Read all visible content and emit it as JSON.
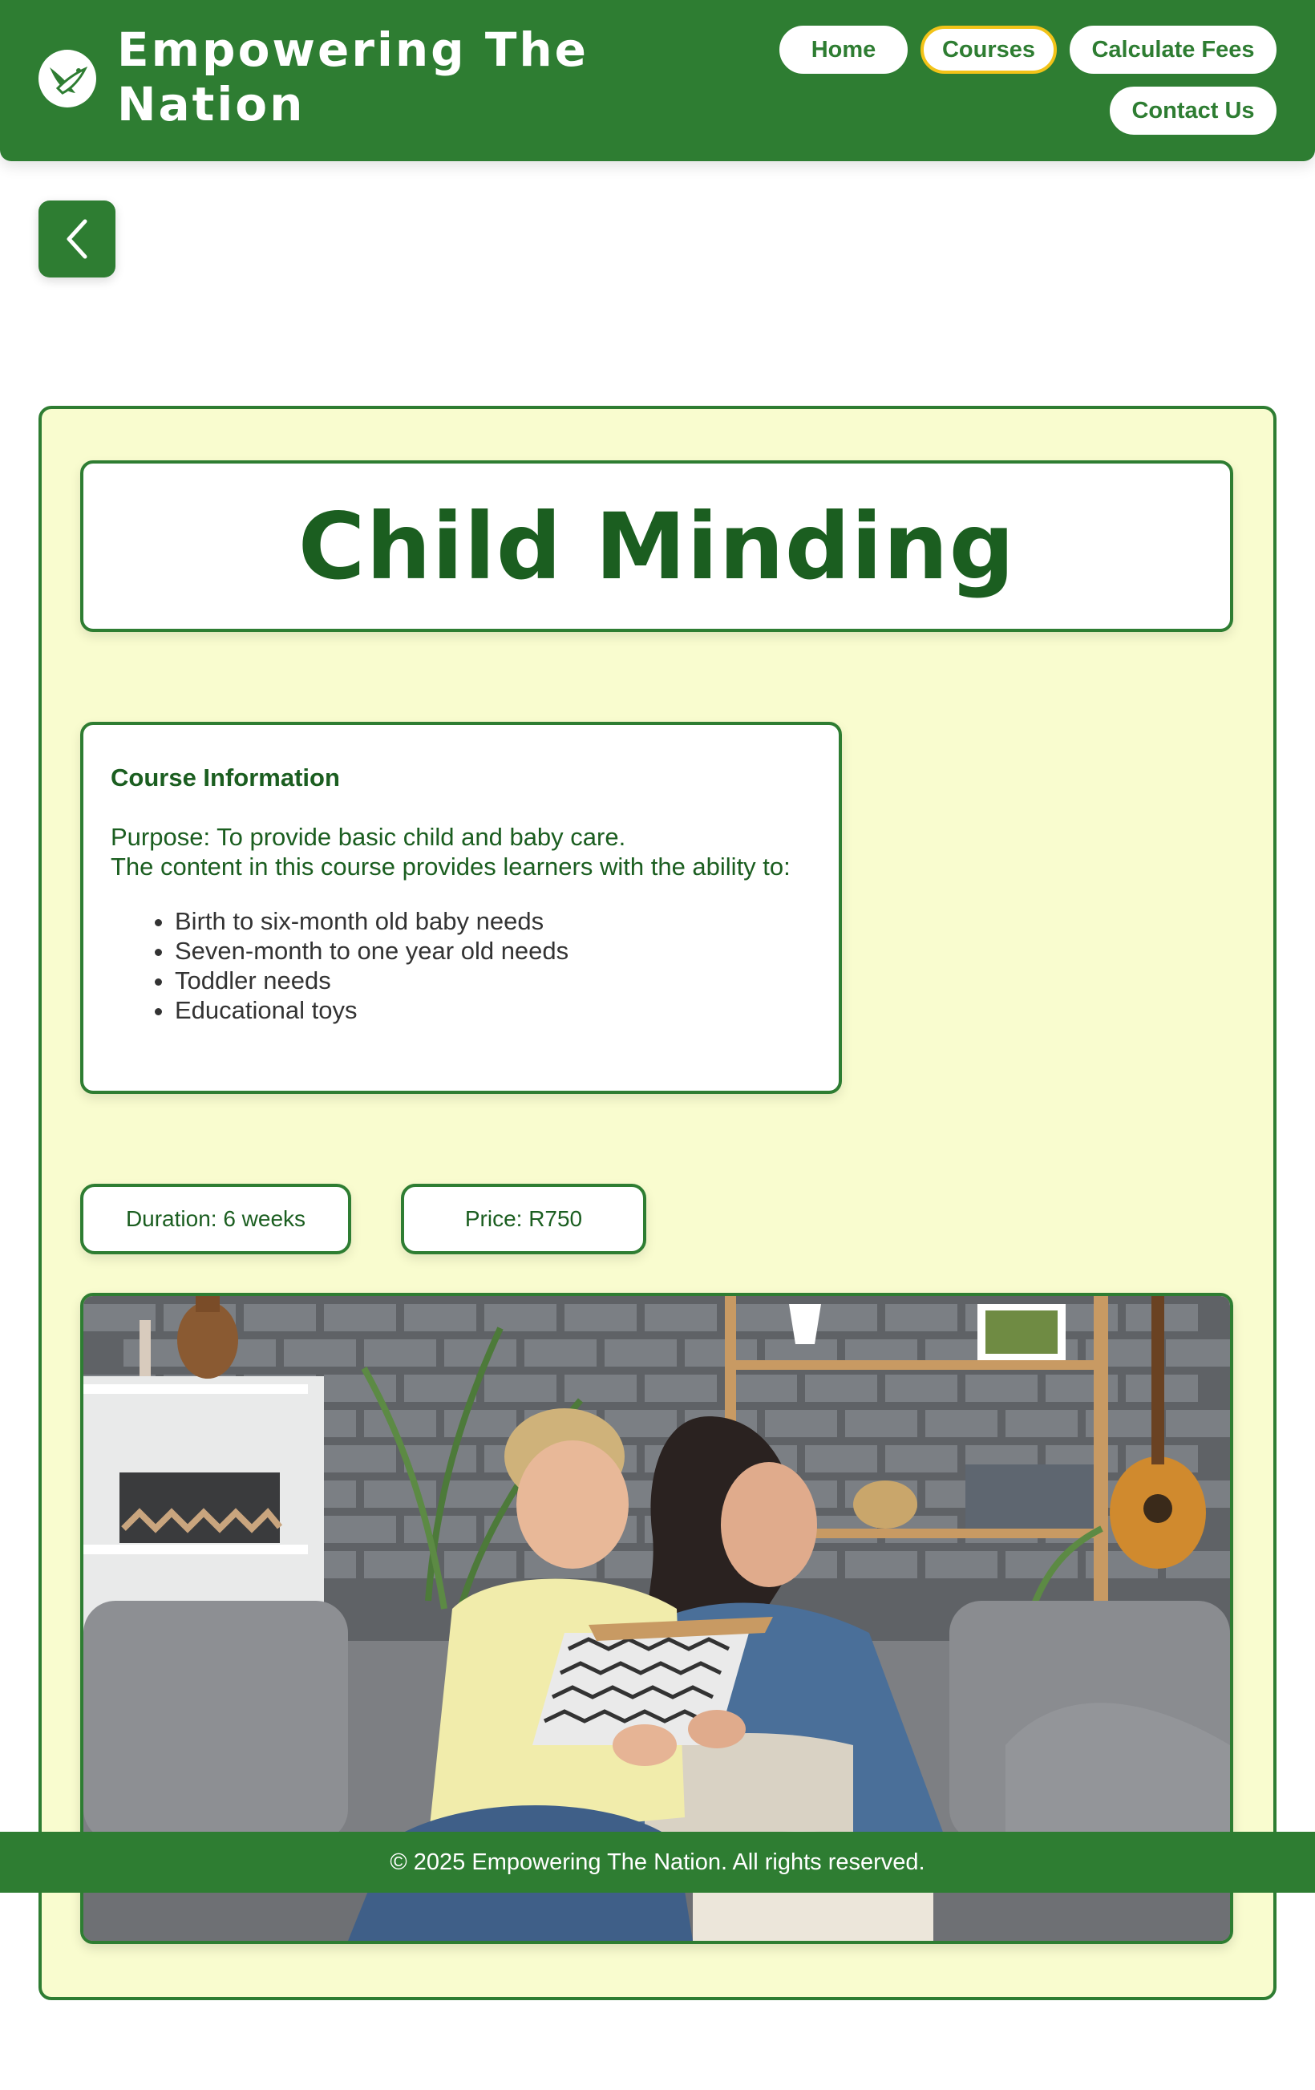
{
  "header": {
    "brand_line1": "Empowering The",
    "brand_line2": "Nation",
    "logo_icon": "bird-logo-icon",
    "nav": {
      "home": "Home",
      "courses": "Courses",
      "fees": "Calculate Fees",
      "contact": "Contact Us"
    },
    "active_nav": "Courses"
  },
  "back_button": {
    "icon": "chevron-left-icon"
  },
  "course": {
    "title": "Child Minding",
    "info_heading": "Course Information",
    "purpose": "Purpose: To provide basic child and baby care.",
    "content_intro": "The content in this course provides learners with the ability to:",
    "items": [
      "Birth to six-month old baby needs",
      "Seven-month to one year old needs",
      "Toddler needs",
      "Educational toys"
    ],
    "duration": "Duration: 6 weeks",
    "price": "Price: R750",
    "image": "photo of a woman reading a book with a boy on a sofa"
  },
  "footer": {
    "text": "© 2025 Empowering The Nation. All rights reserved."
  },
  "colors": {
    "brand_green": "#2e7d32",
    "dark_green": "#1b5e20",
    "panel_bg": "#f9fccf",
    "active_outline": "#f2c318"
  }
}
